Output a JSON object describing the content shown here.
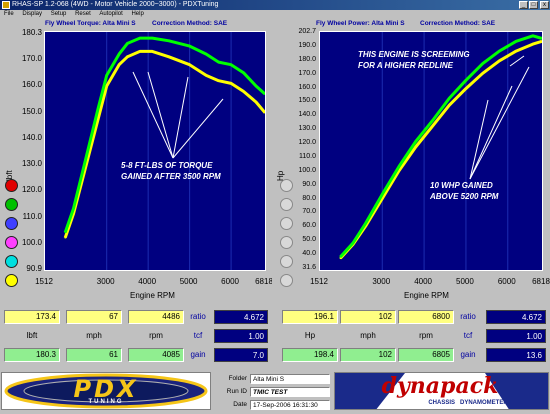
{
  "window": {
    "title": "RHAS-SP 1.2-068  (4WD - Motor Vehicle 2000~3000) - PDXTuning",
    "controls": [
      "_",
      "□",
      "x"
    ]
  },
  "menu": [
    "File",
    "Display",
    "Setup",
    "Reset",
    "Autopilot",
    "Help"
  ],
  "torque_chart": {
    "header_left": "Fly Wheel Torque: Alta Mini S",
    "header_right": "Correction Method: SAE",
    "ylabel": "lbft",
    "xlabel": "Engine RPM",
    "yticks": [
      "180.3",
      "170.0",
      "160.0",
      "150.0",
      "140.0",
      "130.0",
      "120.0",
      "110.0",
      "100.0",
      "90.9"
    ],
    "xticks": [
      "1512",
      "3000",
      "4000",
      "5000",
      "6000",
      "6818"
    ],
    "annotation_l1": "5-8 FT-LBS OF TORQUE",
    "annotation_l2": "GAINED AFTER 3500 RPM"
  },
  "power_chart": {
    "header_left": "Fly Wheel Power: Alta Mini S",
    "header_right": "Correction Method: SAE",
    "ylabel": "Hp",
    "xlabel": "Engine RPM",
    "yticks": [
      "202.7",
      "190.0",
      "180.0",
      "170.0",
      "160.0",
      "150.0",
      "140.0",
      "130.0",
      "120.0",
      "110.0",
      "100.0",
      "90.0",
      "80.0",
      "70.0",
      "60.0",
      "50.0",
      "40.0",
      "31.6"
    ],
    "xticks": [
      "1512",
      "3000",
      "4000",
      "5000",
      "6000",
      "6818"
    ],
    "annotation_top_l1": "THIS ENGINE IS SCREEMING",
    "annotation_top_l2": "FOR A HIGHER REDLINE",
    "annotation_l1": "10 WHP GAINED",
    "annotation_l2": "ABOVE 5200 RPM"
  },
  "chart_data": [
    {
      "type": "line",
      "xlim": [
        1512,
        6818
      ],
      "ylim": [
        90.9,
        180.3
      ],
      "ylabel": "lbft",
      "xlabel": "Engine RPM",
      "series": [
        {
          "color": "#ffff00",
          "x": [
            2000,
            2200,
            2500,
            2800,
            3000,
            3300,
            3500,
            3800,
            4100,
            4500,
            5000,
            5400,
            5700,
            6000,
            6300,
            6600,
            6818
          ],
          "values": [
            103,
            112,
            130,
            148,
            160,
            168,
            171,
            173,
            173,
            171,
            168,
            164,
            162,
            161,
            158,
            154,
            150
          ]
        },
        {
          "color": "#00ff00",
          "x": [
            2000,
            2200,
            2500,
            2800,
            3000,
            3300,
            3500,
            3800,
            4100,
            4500,
            5000,
            5400,
            5700,
            6000,
            6300,
            6600,
            6818
          ],
          "values": [
            105,
            114,
            133,
            152,
            164,
            172,
            176,
            178,
            178,
            177,
            175,
            172,
            169,
            168,
            165,
            160,
            157
          ]
        }
      ]
    },
    {
      "type": "line",
      "xlim": [
        1512,
        6818
      ],
      "ylim": [
        31.6,
        202.7
      ],
      "ylabel": "Hp",
      "xlabel": "Engine RPM",
      "series": [
        {
          "color": "#ffff00",
          "x": [
            2000,
            2300,
            2600,
            3000,
            3400,
            3800,
            4200,
            4600,
            5000,
            5400,
            5800,
            6200,
            6600,
            6818
          ],
          "values": [
            40,
            50,
            63,
            83,
            103,
            120,
            135,
            150,
            162,
            173,
            182,
            189,
            194,
            196
          ]
        },
        {
          "color": "#00ff00",
          "x": [
            2000,
            2300,
            2600,
            3000,
            3400,
            3800,
            4200,
            4600,
            5000,
            5400,
            5800,
            6200,
            6600,
            6818
          ],
          "values": [
            41,
            51,
            65,
            86,
            106,
            124,
            139,
            155,
            168,
            180,
            189,
            196,
            200,
            198
          ]
        }
      ]
    }
  ],
  "readouts": {
    "left": {
      "row1": [
        "173.4",
        "67",
        "4486"
      ],
      "labels": [
        "lbft",
        "mph",
        "rpm"
      ],
      "row3": [
        "180.3",
        "61",
        "4085"
      ],
      "ratio_label": "ratio",
      "ratio": "4.672",
      "tcf_label": "tcf",
      "tcf": "1.00",
      "gain_label": "gain",
      "gain": "7.0"
    },
    "right": {
      "row1": [
        "196.1",
        "102",
        "6800"
      ],
      "labels": [
        "Hp",
        "mph",
        "rpm"
      ],
      "row3": [
        "198.4",
        "102",
        "6805"
      ],
      "ratio_label": "ratio",
      "ratio": "4.672",
      "tcf_label": "tcf",
      "tcf": "1.00",
      "gain_label": "gain",
      "gain": "13.6"
    }
  },
  "run_info": {
    "folder_label": "Folder",
    "folder": "Alta Mini S",
    "runid_label": "Run ID",
    "runid": "TMIC TEST",
    "date_label": "Date",
    "date": "17-Sep-2006  16:31:30"
  },
  "logos": {
    "left_text": "PDX",
    "left_sub": "TUNING",
    "right_text": "dynapack",
    "right_sub": "CHASSIS   DYNAMOMETERS"
  },
  "colors": {
    "plot_bg": "#000080",
    "series_yellow": "#ffff00",
    "series_green": "#00ff00",
    "legend_dots": [
      "#e00000",
      "#00c000",
      "#4040ff",
      "#ff40ff",
      "#00e0e0",
      "#ffff00"
    ]
  }
}
